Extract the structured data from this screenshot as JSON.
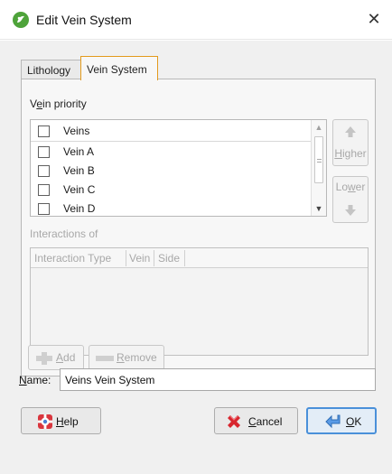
{
  "window": {
    "title": "Edit Vein System",
    "close_glyph": "✕",
    "app_icon": "leapfrog-app-icon"
  },
  "tabs": [
    {
      "label": "Lithology",
      "active": false
    },
    {
      "label": "Vein System",
      "active": true
    }
  ],
  "vein_priority": {
    "label_pre": "V",
    "label_accel": "e",
    "label_post": "in priority",
    "header": "Veins",
    "rows": [
      "Vein A",
      "Vein B",
      "Vein C",
      "Vein D"
    ],
    "scroll_up_glyph": "▲",
    "scroll_down_glyph": "▼",
    "higher": {
      "accel": "H",
      "rest": "igher",
      "enabled": false
    },
    "lower": {
      "pre": "Lo",
      "accel": "w",
      "post": "er",
      "enabled": false
    }
  },
  "interactions": {
    "label": "Interactions of",
    "columns": [
      "Interaction Type",
      "Vein",
      "Side"
    ],
    "add": {
      "accel": "A",
      "rest": "dd",
      "enabled": false
    },
    "remove": {
      "accel": "R",
      "rest": "emove",
      "enabled": false
    }
  },
  "name_field": {
    "label_accel": "N",
    "label_rest": "ame:",
    "value": "Veins Vein System"
  },
  "buttons": {
    "help": {
      "accel": "H",
      "rest": "elp"
    },
    "cancel": {
      "accel": "C",
      "rest": "ancel"
    },
    "ok": {
      "accel": "O",
      "rest": "K"
    }
  },
  "colors": {
    "active_tab_border": "#e39a1c",
    "ok_focus_border": "#4a90d9",
    "app_icon": "#4ea33a",
    "disabled_text": "#a8a8a8"
  }
}
